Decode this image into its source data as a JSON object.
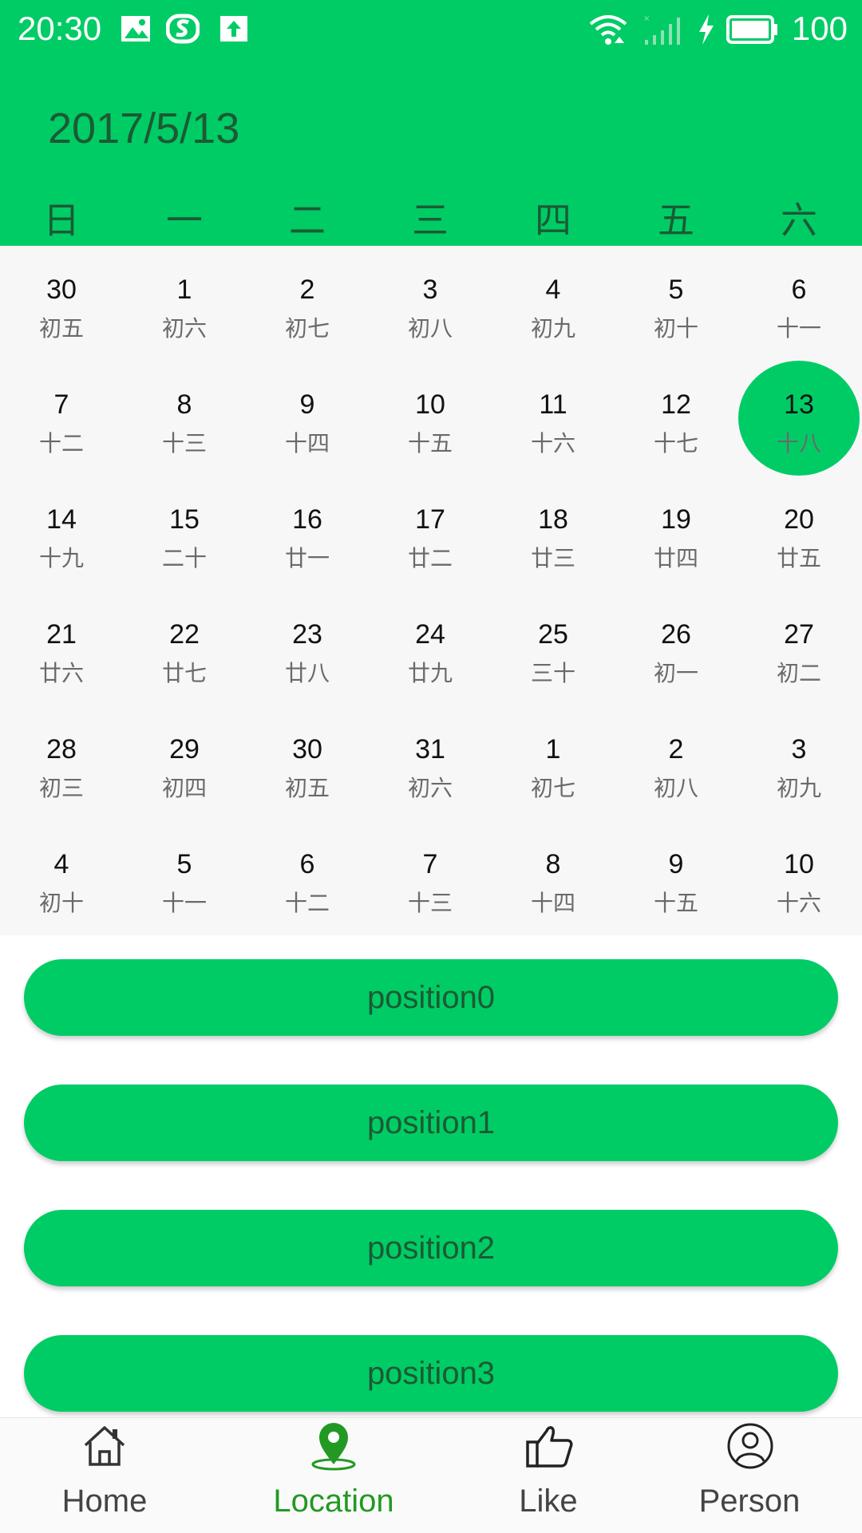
{
  "status_bar": {
    "time": "20:30",
    "battery": "100",
    "icons": [
      "image-icon",
      "sogou-icon",
      "upload-icon",
      "wifi-icon",
      "signal-icon",
      "charging-icon",
      "battery-icon"
    ]
  },
  "header": {
    "date": "2017/5/13",
    "weekdays": [
      "日",
      "一",
      "二",
      "三",
      "四",
      "五",
      "六"
    ]
  },
  "calendar": {
    "selected": "13",
    "accent_color": "#00cc66",
    "weeks": [
      [
        [
          "30",
          "初五"
        ],
        [
          "1",
          "初六"
        ],
        [
          "2",
          "初七"
        ],
        [
          "3",
          "初八"
        ],
        [
          "4",
          "初九"
        ],
        [
          "5",
          "初十"
        ],
        [
          "6",
          "十一"
        ]
      ],
      [
        [
          "7",
          "十二"
        ],
        [
          "8",
          "十三"
        ],
        [
          "9",
          "十四"
        ],
        [
          "10",
          "十五"
        ],
        [
          "11",
          "十六"
        ],
        [
          "12",
          "十七"
        ],
        [
          "13",
          "十八"
        ]
      ],
      [
        [
          "14",
          "十九"
        ],
        [
          "15",
          "二十"
        ],
        [
          "16",
          "廿一"
        ],
        [
          "17",
          "廿二"
        ],
        [
          "18",
          "廿三"
        ],
        [
          "19",
          "廿四"
        ],
        [
          "20",
          "廿五"
        ]
      ],
      [
        [
          "21",
          "廿六"
        ],
        [
          "22",
          "廿七"
        ],
        [
          "23",
          "廿八"
        ],
        [
          "24",
          "廿九"
        ],
        [
          "25",
          "三十"
        ],
        [
          "26",
          "初一"
        ],
        [
          "27",
          "初二"
        ]
      ],
      [
        [
          "28",
          "初三"
        ],
        [
          "29",
          "初四"
        ],
        [
          "30",
          "初五"
        ],
        [
          "31",
          "初六"
        ],
        [
          "1",
          "初七"
        ],
        [
          "2",
          "初八"
        ],
        [
          "3",
          "初九"
        ]
      ],
      [
        [
          "4",
          "初十"
        ],
        [
          "5",
          "十一"
        ],
        [
          "6",
          "十二"
        ],
        [
          "7",
          "十三"
        ],
        [
          "8",
          "十四"
        ],
        [
          "9",
          "十五"
        ],
        [
          "10",
          "十六"
        ]
      ]
    ]
  },
  "list": {
    "buttons": [
      "position0",
      "position1",
      "position2",
      "position3"
    ]
  },
  "bottom_nav": {
    "active": "Location",
    "items": [
      {
        "label": "Home",
        "icon": "home-icon"
      },
      {
        "label": "Location",
        "icon": "location-pin-icon"
      },
      {
        "label": "Like",
        "icon": "thumbs-up-icon"
      },
      {
        "label": "Person",
        "icon": "person-icon"
      }
    ]
  }
}
